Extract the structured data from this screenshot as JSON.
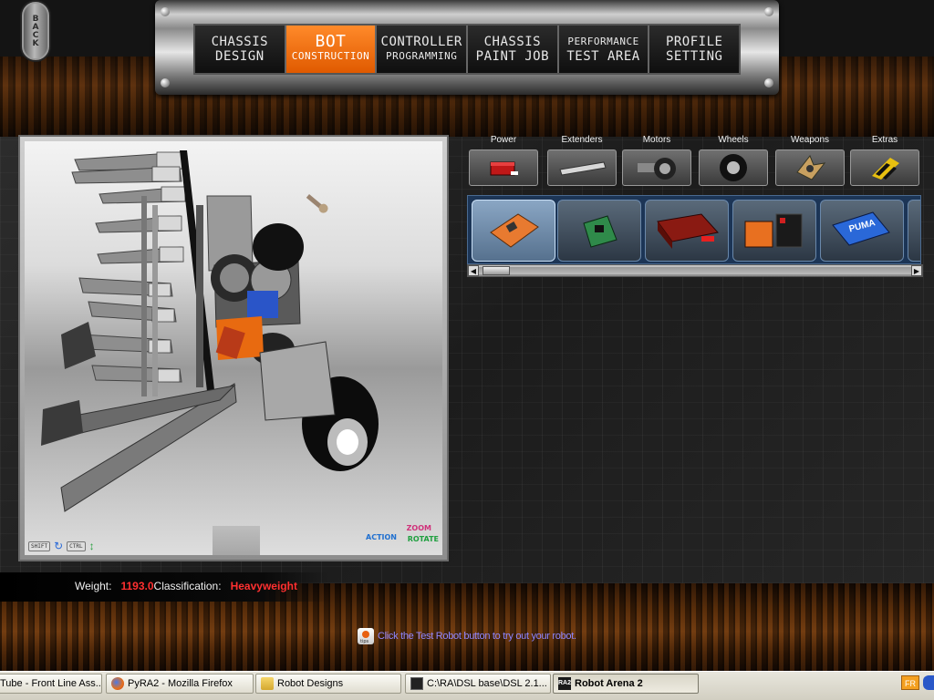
{
  "back_button": {
    "label": "BACK"
  },
  "nav": {
    "tabs": [
      {
        "line1": "CHASSIS",
        "line2": "DESIGN",
        "active": false
      },
      {
        "line1": "BOT",
        "line2": "CONSTRUCTION",
        "active": true
      },
      {
        "line1": "CONTROLLER",
        "line2": "PROGRAMMING",
        "active": false
      },
      {
        "line1": "CHASSIS",
        "line2": "PAINT JOB",
        "active": false
      },
      {
        "line1": "PERFORMANCE",
        "line2": "TEST AREA",
        "active": false
      },
      {
        "line1": "PROFILE",
        "line2": "SETTING",
        "active": false
      }
    ]
  },
  "viewport": {
    "controls": {
      "shift": "SHIFT",
      "ctrl": "CTRL"
    },
    "camera": {
      "zoom": "ZOOM",
      "action": "ACTION",
      "rotate": "ROTATE"
    }
  },
  "categories": [
    {
      "label": "Power",
      "icon": "battery-icon"
    },
    {
      "label": "Extenders",
      "icon": "extender-bar-icon"
    },
    {
      "label": "Motors",
      "icon": "motor-icon"
    },
    {
      "label": "Wheels",
      "icon": "wheel-icon"
    },
    {
      "label": "Weapons",
      "icon": "weapon-blade-icon"
    },
    {
      "label": "Extras",
      "icon": "extras-stripes-icon"
    }
  ],
  "parts": [
    {
      "name": "orange-controller-part",
      "selected": true
    },
    {
      "name": "green-circuit-board-part",
      "selected": false
    },
    {
      "name": "red-battery-pack-part",
      "selected": false
    },
    {
      "name": "twin-battery-part",
      "selected": false
    },
    {
      "name": "puma-battery-part",
      "selected": false,
      "label": "PUMA"
    }
  ],
  "stats": {
    "weight_label": "Weight:",
    "weight_value": "1193.0",
    "class_label": "Classification:",
    "class_value": "Heavyweight"
  },
  "tip": {
    "icon_label": "tips",
    "text": "Click the Test Robot button to try out your robot."
  },
  "taskbar": {
    "items": [
      {
        "label": "Tube - Front Line Ass...",
        "icon": "youtube-icon",
        "active": false
      },
      {
        "label": "PyRA2 - Mozilla Firefox",
        "icon": "firefox-icon",
        "active": false
      },
      {
        "label": "Robot Designs",
        "icon": "folder-icon",
        "active": false
      },
      {
        "label": "C:\\RA\\DSL base\\DSL 2.1...",
        "icon": "console-icon",
        "active": false
      },
      {
        "label": "Robot Arena 2",
        "icon": "ra2-icon",
        "active": true
      }
    ],
    "tray_lang": "FR"
  },
  "colors": {
    "accent_orange": "#e86a10",
    "stat_red": "#ff3030",
    "tip_text": "#8f86ff",
    "parts_strip_blue": "#1c3556"
  }
}
